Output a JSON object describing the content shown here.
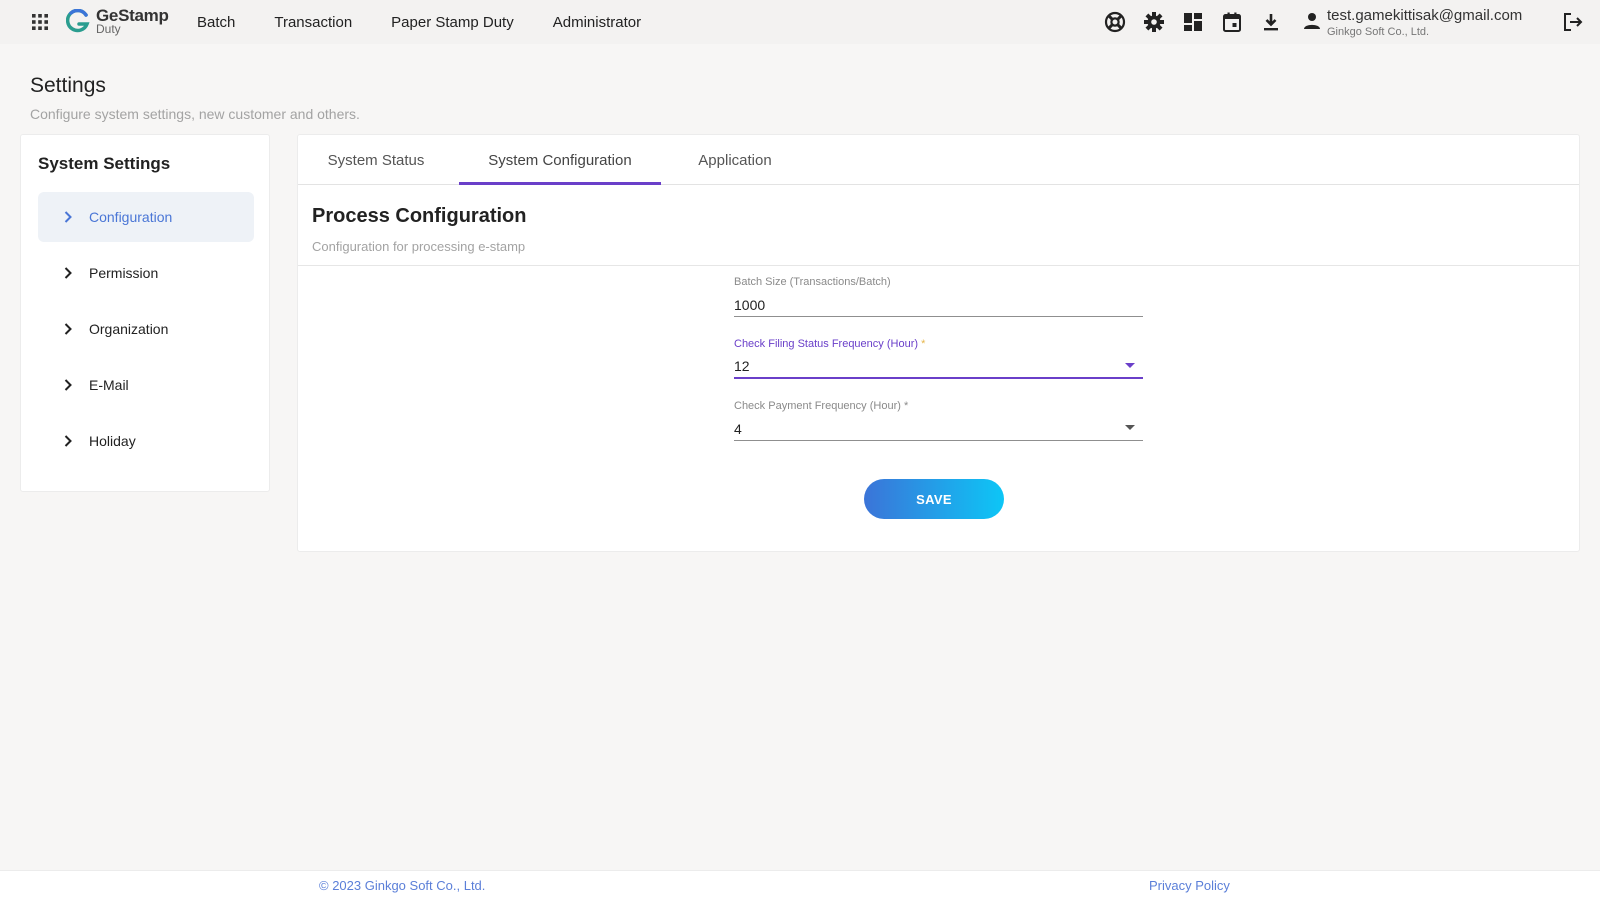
{
  "header": {
    "logo_line1": "GeStamp",
    "logo_line2": "Duty",
    "nav": [
      {
        "label": "Batch"
      },
      {
        "label": "Transaction"
      },
      {
        "label": "Paper Stamp Duty"
      },
      {
        "label": "Administrator"
      }
    ],
    "icons": [
      "apps-grid-icon",
      "help-lifebuoy-icon",
      "gear-icon",
      "dashboard-icon",
      "calendar-icon",
      "download-icon",
      "user-icon",
      "logout-icon"
    ],
    "user_email": "test.gamekittisak@gmail.com",
    "user_org": "Ginkgo Soft Co., Ltd."
  },
  "page": {
    "title": "Settings",
    "subtitle": "Configure system settings, new customer and others."
  },
  "sidebar": {
    "title": "System Settings",
    "items": [
      {
        "label": "Configuration",
        "active": true
      },
      {
        "label": "Permission"
      },
      {
        "label": "Organization"
      },
      {
        "label": "E-Mail"
      },
      {
        "label": "Holiday"
      }
    ]
  },
  "tabs": [
    {
      "label": "System Status"
    },
    {
      "label": "System Configuration",
      "active": true
    },
    {
      "label": "Application"
    }
  ],
  "section": {
    "title": "Process Configuration",
    "subtitle": "Configuration for processing e-stamp"
  },
  "form": {
    "batch_size": {
      "label": "Batch Size (Transactions/Batch)",
      "value": "1000"
    },
    "filing_freq": {
      "label": "Check Filing Status Frequency (Hour)",
      "required": "*",
      "value": "12"
    },
    "payment_freq": {
      "label": "Check Payment Frequency (Hour)",
      "required": "*",
      "value": "4"
    },
    "save_label": "SAVE"
  },
  "footer": {
    "copyright": "© 2023 Ginkgo Soft Co., Ltd.",
    "privacy": "Privacy Policy"
  },
  "colors": {
    "accent": "#6a3fc9",
    "link": "#5b7fd8",
    "button_start": "#3b74d8",
    "button_end": "#0dc6f6"
  }
}
